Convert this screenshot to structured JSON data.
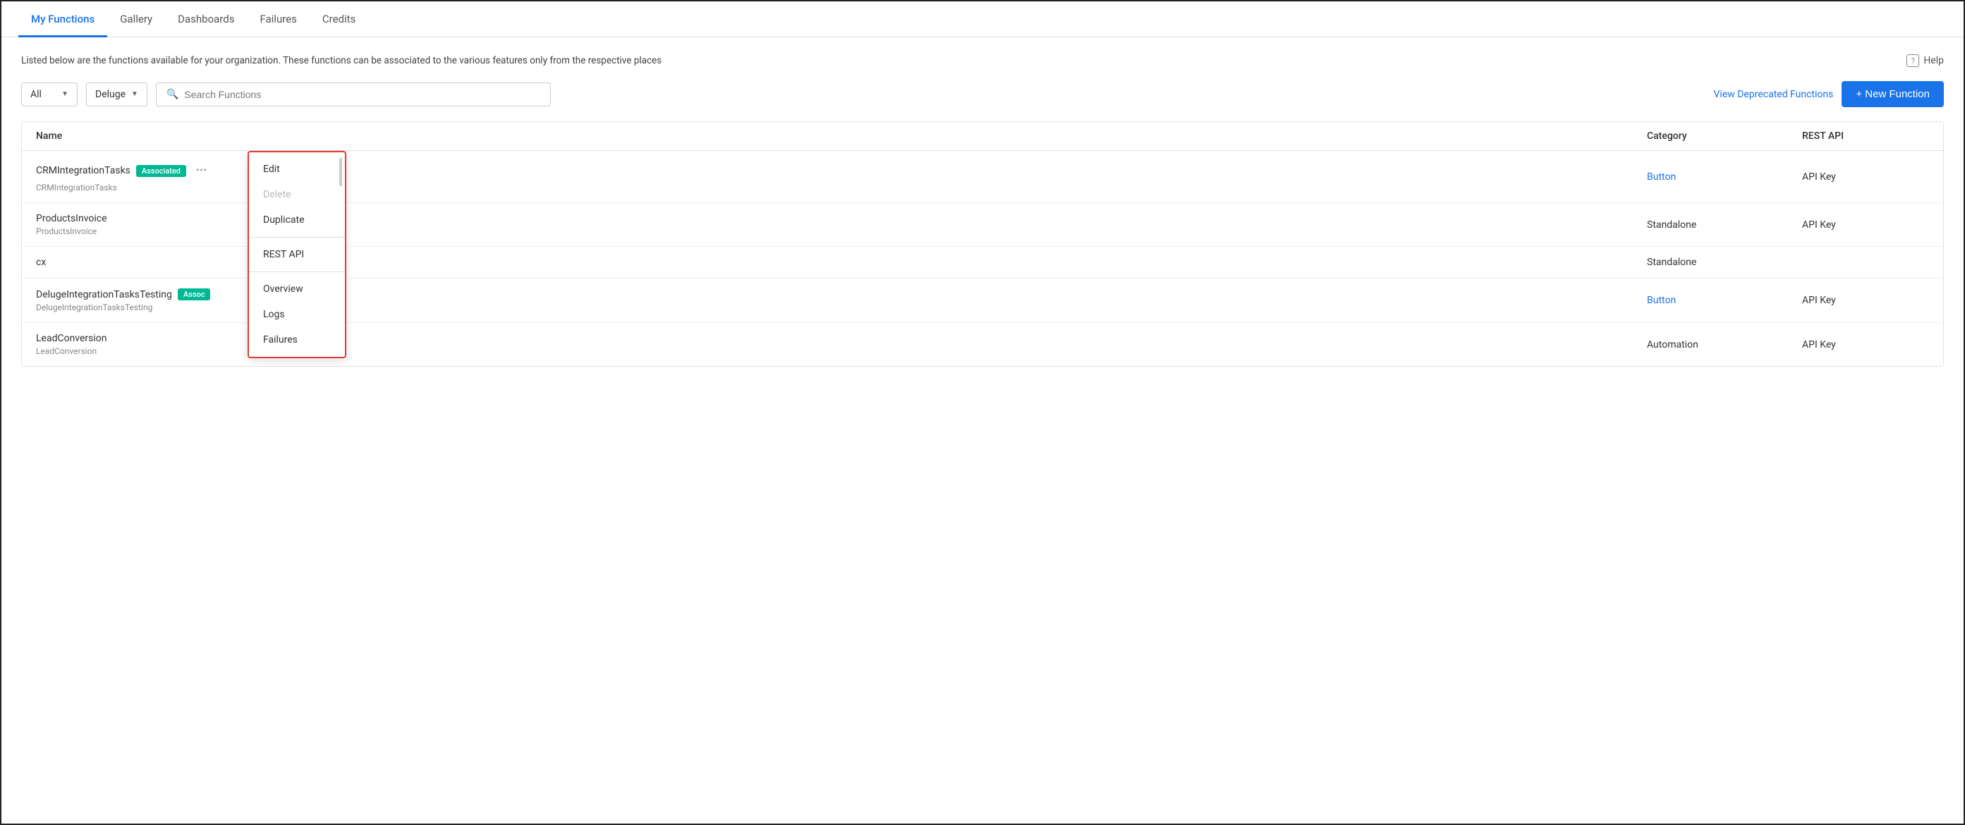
{
  "app": {
    "title": "My Functions"
  },
  "nav": {
    "tabs": [
      {
        "id": "my-functions",
        "label": "My Functions",
        "active": true
      },
      {
        "id": "gallery",
        "label": "Gallery",
        "active": false
      },
      {
        "id": "dashboards",
        "label": "Dashboards",
        "active": false
      },
      {
        "id": "failures",
        "label": "Failures",
        "active": false
      },
      {
        "id": "credits",
        "label": "Credits",
        "active": false
      }
    ]
  },
  "description": {
    "text": "Listed below are the functions available for your organization. These functions can be associated to the various features only from the respective places",
    "help_label": "Help"
  },
  "filters": {
    "category_filter": {
      "value": "All",
      "placeholder": "All"
    },
    "language_filter": {
      "value": "Deluge",
      "placeholder": "Deluge"
    },
    "search": {
      "placeholder": "Search Functions",
      "value": ""
    }
  },
  "actions": {
    "view_deprecated": "View Deprecated Functions",
    "new_function": "+ New Function"
  },
  "table": {
    "headers": {
      "name": "Name",
      "category": "Category",
      "rest_api": "REST API"
    },
    "rows": [
      {
        "id": "crm-integration-tasks",
        "name": "CRMIntegrationTasks",
        "subtitle": "CRMIntegrationTasks",
        "badge": "Associated",
        "has_more": true,
        "category": "Button",
        "category_is_link": true,
        "rest_api": "API Key"
      },
      {
        "id": "products-invoice",
        "name": "ProductsInvoice",
        "subtitle": "ProductsInvoice",
        "badge": null,
        "has_more": false,
        "category": "Standalone",
        "category_is_link": false,
        "rest_api": "API Key"
      },
      {
        "id": "cx",
        "name": "cx",
        "subtitle": "",
        "badge": null,
        "has_more": false,
        "category": "Standalone",
        "category_is_link": false,
        "rest_api": ""
      },
      {
        "id": "deluge-integration-tasks-testing",
        "name": "DelugeIntegrationTasksTesting",
        "subtitle": "DelugeIntegrationTasksTesting",
        "badge": "Assoc",
        "has_more": false,
        "category": "Button",
        "category_is_link": true,
        "rest_api": "API Key"
      },
      {
        "id": "lead-conversion",
        "name": "LeadConversion",
        "subtitle": "LeadConversion",
        "badge": null,
        "has_more": false,
        "category": "Automation",
        "category_is_link": false,
        "rest_api": "API Key"
      }
    ]
  },
  "context_menu": {
    "items": [
      {
        "id": "edit",
        "label": "Edit",
        "disabled": false
      },
      {
        "id": "delete",
        "label": "Delete",
        "disabled": true
      },
      {
        "id": "duplicate",
        "label": "Duplicate",
        "disabled": false
      },
      {
        "id": "rest-api",
        "label": "REST API",
        "disabled": false
      },
      {
        "id": "overview",
        "label": "Overview",
        "disabled": false
      },
      {
        "id": "logs",
        "label": "Logs",
        "disabled": false
      },
      {
        "id": "failures",
        "label": "Failures",
        "disabled": false
      }
    ]
  }
}
